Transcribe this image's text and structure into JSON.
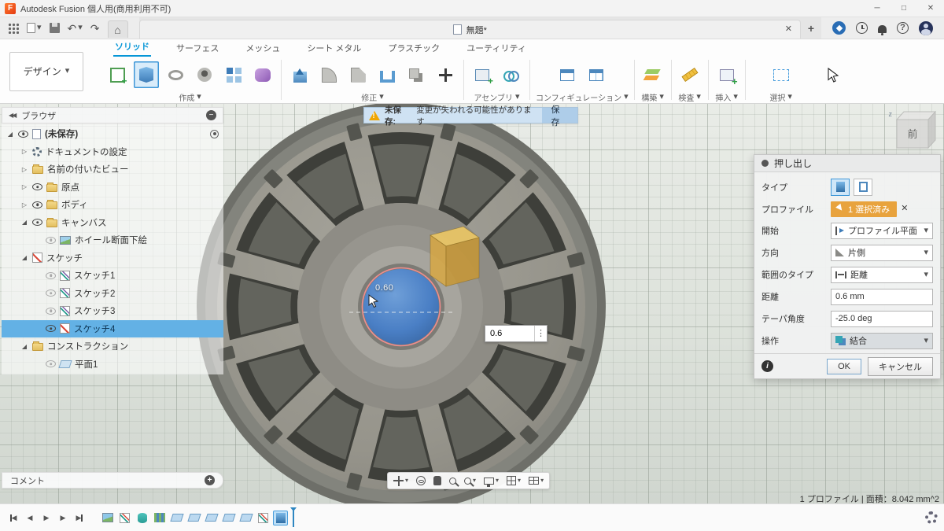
{
  "titlebar": {
    "app_title": "Autodesk Fusion 個人用(商用利用不可)"
  },
  "doc_tab": {
    "title": "無題*"
  },
  "ribbon": {
    "workspace_label": "デザイン",
    "tabs": [
      {
        "label": "ソリッド",
        "active": true
      },
      {
        "label": "サーフェス",
        "active": false
      },
      {
        "label": "メッシュ",
        "active": false
      },
      {
        "label": "シート メタル",
        "active": false
      },
      {
        "label": "プラスチック",
        "active": false
      },
      {
        "label": "ユーティリティ",
        "active": false
      }
    ],
    "groups": [
      {
        "label": "作成"
      },
      {
        "label": "修正"
      },
      {
        "label": "アセンブリ"
      },
      {
        "label": "コンフィギュレーション"
      },
      {
        "label": "構築"
      },
      {
        "label": "検査"
      },
      {
        "label": "挿入"
      },
      {
        "label": "選択"
      }
    ]
  },
  "browser": {
    "title": "ブラウザ",
    "items": [
      {
        "label": "(未保存)"
      },
      {
        "label": "ドキュメントの設定"
      },
      {
        "label": "名前の付いたビュー"
      },
      {
        "label": "原点"
      },
      {
        "label": "ボディ"
      },
      {
        "label": "キャンバス"
      },
      {
        "label": "ホイール断面下絵"
      },
      {
        "label": "スケッチ"
      },
      {
        "label": "スケッチ1"
      },
      {
        "label": "スケッチ2"
      },
      {
        "label": "スケッチ3"
      },
      {
        "label": "スケッチ4"
      },
      {
        "label": "コンストラクション"
      },
      {
        "label": "平面1"
      }
    ]
  },
  "warning_bar": {
    "label": "未保存:",
    "message": "変更が失われる可能性があります",
    "save_button": "保存"
  },
  "dialog": {
    "title": "押し出し",
    "type_label": "タイプ",
    "profile_label": "プロファイル",
    "profile_value": "1 選択済み",
    "start_label": "開始",
    "start_value": "プロファイル平面",
    "direction_label": "方向",
    "direction_value": "片側",
    "extent_label": "範囲のタイプ",
    "extent_value": "距離",
    "distance_label": "距離",
    "distance_value": "0.6 mm",
    "taper_label": "テーパ角度",
    "taper_value": "-25.0 deg",
    "operation_label": "操作",
    "operation_value": "結合",
    "ok_button": "OK",
    "cancel_button": "キャンセル"
  },
  "viewport": {
    "dimension_label": "0.60",
    "distance_input": "0.6",
    "viewcube_front": "前",
    "status_text": "1 プロファイル | 面積：8.042 mm^2"
  },
  "comment_panel": {
    "title": "コメント"
  },
  "colors": {
    "accent_blue": "#0696d7",
    "selection_orange": "#e8a33d",
    "hub_blue": "#4a7fc5",
    "profile_pink": "#f08d8d",
    "preview_yellow": "#e8ba56"
  }
}
